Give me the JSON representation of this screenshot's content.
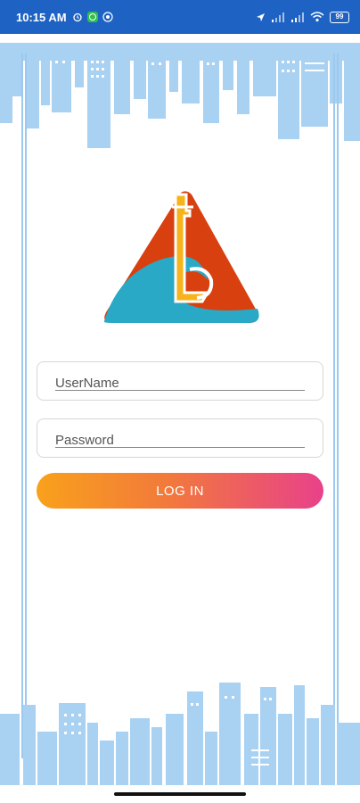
{
  "status_bar": {
    "time": "10:15 AM",
    "left_icons": [
      "alarm-icon",
      "whatsapp-icon",
      "vpn-icon"
    ],
    "right_icons": [
      "location-arrow-icon",
      "signal-icon",
      "signal-icon",
      "wifi-icon"
    ],
    "battery": "99"
  },
  "login": {
    "username_placeholder": "UserName",
    "password_placeholder": "Password",
    "button_label": "LOG IN"
  },
  "colors": {
    "status_bar": "#1e63c4",
    "skyline": "#a9d1f2",
    "logo_red": "#d9400f",
    "logo_teal": "#29a9c6",
    "logo_yellow": "#f7b31c",
    "button_start": "#f9a11b",
    "button_end": "#e8418a"
  }
}
